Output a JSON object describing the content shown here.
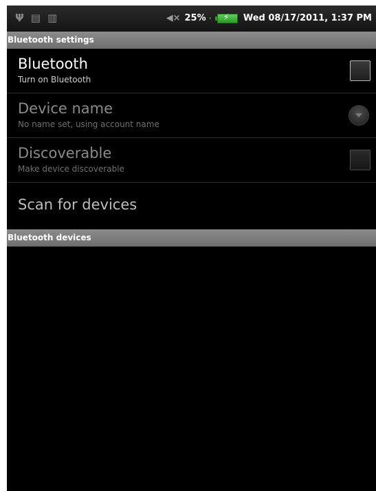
{
  "status_bar": {
    "left_icons": [
      "usb-icon",
      "android-debug-icon",
      "sd-card-icon"
    ],
    "volume_icon": "muted-speaker-icon",
    "battery_percent": "25%",
    "battery_icon": "battery-charging-icon",
    "datetime": "Wed 08/17/2011, 1:37 PM"
  },
  "sections": {
    "settings_header": "Bluetooth settings",
    "devices_header": "Bluetooth devices"
  },
  "settings": {
    "bluetooth": {
      "title": "Bluetooth",
      "summary": "Turn on Bluetooth",
      "checked": false,
      "enabled": true
    },
    "device_name": {
      "title": "Device name",
      "summary": "No name set, using account name",
      "enabled": false
    },
    "discoverable": {
      "title": "Discoverable",
      "summary": "Make device discoverable",
      "checked": false,
      "enabled": false
    },
    "scan": {
      "title": "Scan for devices"
    }
  },
  "colors": {
    "background": "#000000",
    "section_header": "#7d7d7d",
    "battery": "#3aa636"
  }
}
